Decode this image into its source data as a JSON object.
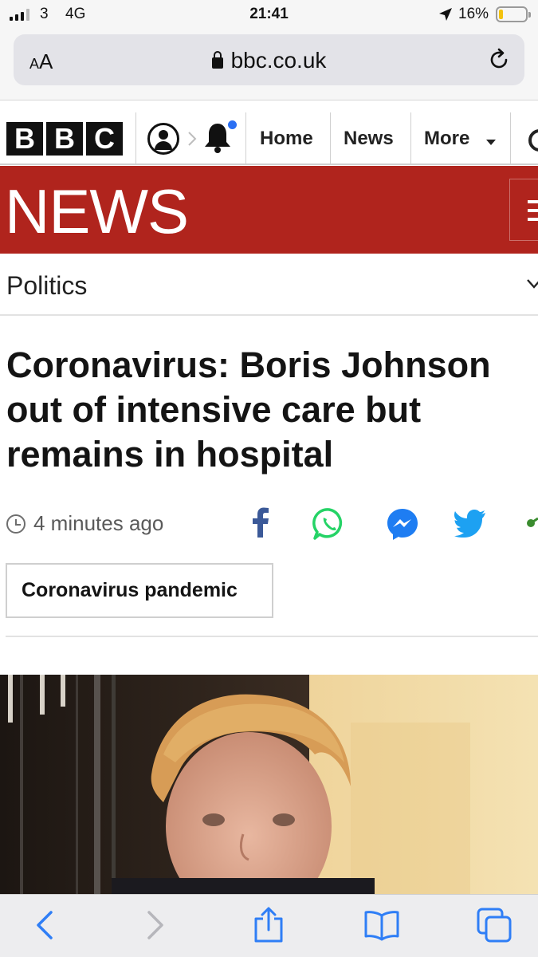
{
  "status_bar": {
    "carrier": "3",
    "network": "4G",
    "time": "21:41",
    "battery_percent": "16%",
    "battery_level": 0.16,
    "signal_bars_active": 3,
    "battery_color": "#f3c20e"
  },
  "browser": {
    "text_size_button": "AA",
    "url": "bbc.co.uk",
    "icons": [
      "lock-icon",
      "reload-icon",
      "back-icon",
      "forward-icon",
      "share-icon",
      "bookmarks-icon",
      "tabs-icon"
    ]
  },
  "bbc_nav": {
    "logo_letters": [
      "B",
      "B",
      "C"
    ],
    "links": [
      "Home",
      "News",
      "More"
    ],
    "icons": [
      "account-icon",
      "notification-bell-icon",
      "search-icon"
    ],
    "notification_dot_color": "#2a6ff3"
  },
  "news_banner": {
    "wordmark": "NEWS",
    "color": "#b0241d"
  },
  "section": {
    "label": "Politics"
  },
  "article": {
    "headline": "Coronavirus: Boris Johnson out of intensive care but remains in hospital",
    "timestamp": "4 minutes ago",
    "share_icons": [
      "facebook-icon",
      "whatsapp-icon",
      "messenger-icon",
      "twitter-icon",
      "share-link-icon"
    ],
    "topic_tag": "Coronavirus pandemic"
  }
}
